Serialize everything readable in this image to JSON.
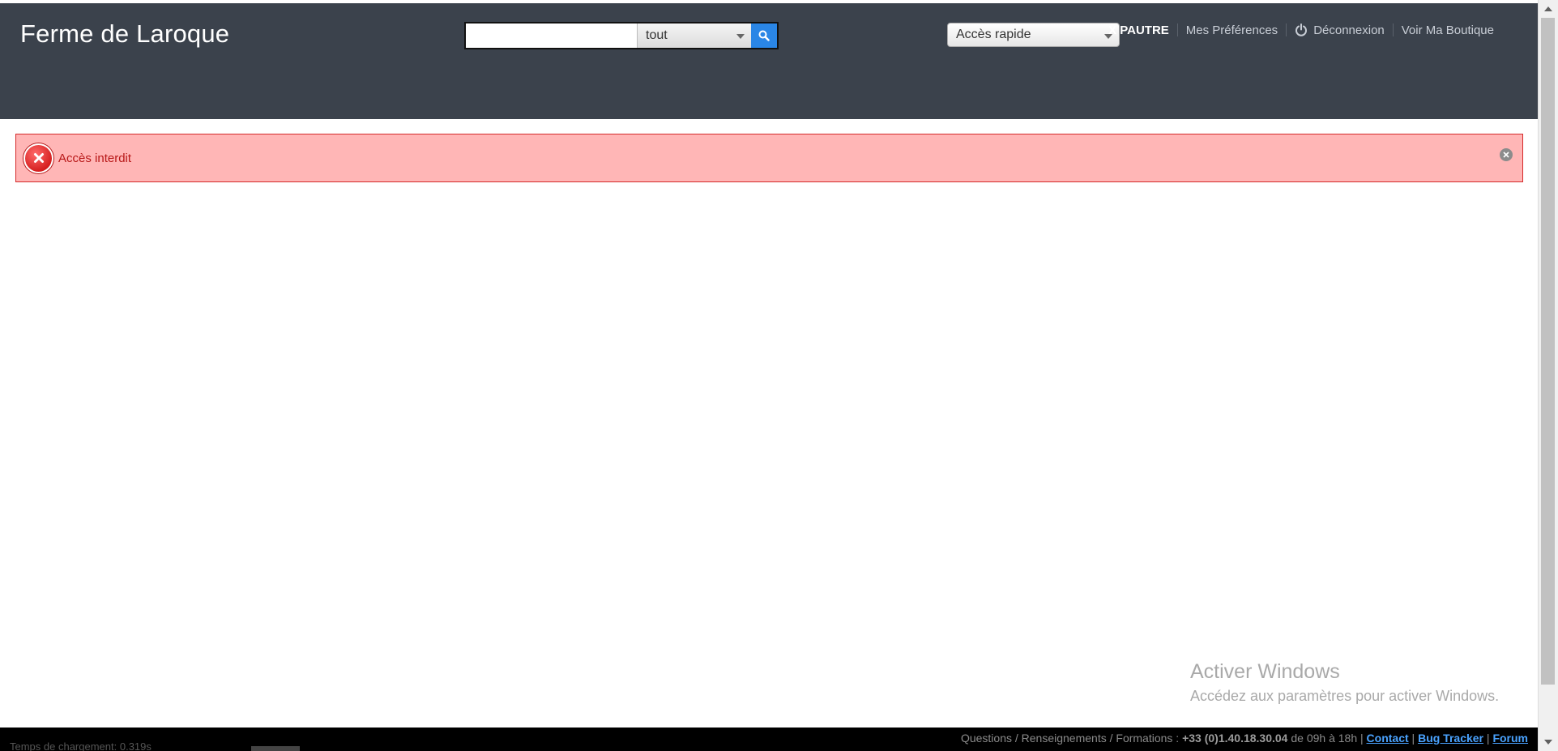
{
  "header": {
    "site_title": "Ferme de Laroque",
    "search": {
      "placeholder": "",
      "value": "",
      "scope_selected": "tout"
    },
    "quick_access": {
      "selected": "Accès rapide"
    },
    "user_nav": {
      "user_name": "X PAUTRE",
      "preferences": "Mes Préférences",
      "logout": "Déconnexion",
      "view_shop": "Voir Ma Boutique"
    }
  },
  "alert": {
    "message": "Accès interdit",
    "type": "error",
    "color": "#ffb6b6"
  },
  "watermark": {
    "title": "Activer Windows",
    "subtitle": "Accédez aux paramètres pour activer Windows."
  },
  "footer": {
    "left_text": "Temps de chargement: 0.319s",
    "questions": "Questions / Renseignements / Formations :",
    "phone": "+33 (0)1.40.18.30.04",
    "hours": "de 09h à 18h |",
    "contact": "Contact",
    "bug_tracker": "Bug Tracker",
    "forum": "Forum"
  },
  "colors": {
    "header_bg": "#3b424c",
    "search_button": "#2a86e6",
    "alert_border": "#d42a2a",
    "alert_text": "#b81818"
  },
  "icons": {
    "search_button": "search-icon",
    "logout": "power-icon",
    "alert": "error-x-icon",
    "alert_close": "close-icon"
  }
}
